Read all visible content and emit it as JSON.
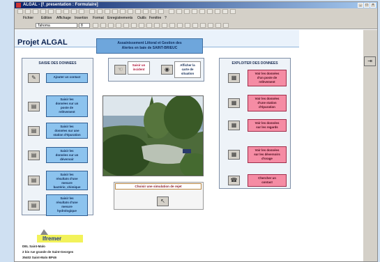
{
  "window": {
    "title": "ALGAL - [f_presentation : Formulaire]"
  },
  "menu": [
    "Fichier",
    "Edition",
    "Affichage",
    "Insertion",
    "Format",
    "Enregistrements",
    "Outils",
    "Fenêtre",
    "?"
  ],
  "format_bar": {
    "font": "Tahoma",
    "size": "8"
  },
  "form": {
    "title": "Projet ALGAL",
    "banner": [
      "Assainissement Littoral et Gestion des",
      "Alertes en baie de SAINT-BRIEUC"
    ]
  },
  "top_buttons": [
    {
      "label": [
        "Saisir un",
        "incident"
      ],
      "icon": "hand-icon",
      "style": "white"
    },
    {
      "label": [
        "Afficher la",
        "carte de",
        "situation"
      ],
      "icon": "globe-icon",
      "style": "white"
    }
  ],
  "left_panel": {
    "title": "SAISIE DES DONNEES",
    "buttons": [
      {
        "label": [
          "Ajouter un contact"
        ],
        "icon": "contact-icon"
      },
      {
        "label": [
          "Saisir les",
          "données sur un",
          "poste de",
          "relèvement"
        ],
        "icon": "form-icon"
      },
      {
        "label": [
          "Saisir les",
          "données sur une",
          "station d'épuration"
        ],
        "icon": "form-icon"
      },
      {
        "label": [
          "Saisir les",
          "données sur un",
          "déversoir"
        ],
        "icon": "form-icon"
      },
      {
        "label": [
          "Saisir les",
          "résultats d'une",
          "mesure",
          "bactério_chimique"
        ],
        "icon": "form-icon"
      },
      {
        "label": [
          "Saisir les",
          "résultats d'une",
          "mesure",
          "hydrologique"
        ],
        "icon": "form-icon"
      }
    ]
  },
  "right_panel": {
    "title": "EXPLOITER DES DONNEES",
    "buttons": [
      {
        "label": [
          "Voir les données",
          "d'un poste de",
          "relèvement"
        ],
        "icon": "report-icon"
      },
      {
        "label": [
          "Voir les données",
          "d'une station",
          "d'épuration"
        ],
        "icon": "report-icon"
      },
      {
        "label": [
          "Voir les données",
          "sur les regards"
        ],
        "icon": "report-icon"
      },
      {
        "label": [
          "Voir les données",
          "sur les déversoirs",
          "d'orage"
        ],
        "icon": "report-icon"
      },
      {
        "label": [
          "Chercher un",
          "contact"
        ],
        "icon": "phone-icon"
      }
    ]
  },
  "simulation": {
    "label": "Choisir une simulation de rejet",
    "icon": "cursor-icon"
  },
  "footer": {
    "logo": "Ifremer",
    "address": [
      "DEL Saint-Malo",
      "2 bis rue grande de Saint-Georges",
      "35402 Saint-Malo BP46"
    ]
  },
  "colors": {
    "blue_button": "#8cc3ee",
    "pink_button": "#f58ca4",
    "banner": "#6ea6dc",
    "form_bg": "#ffffff"
  }
}
